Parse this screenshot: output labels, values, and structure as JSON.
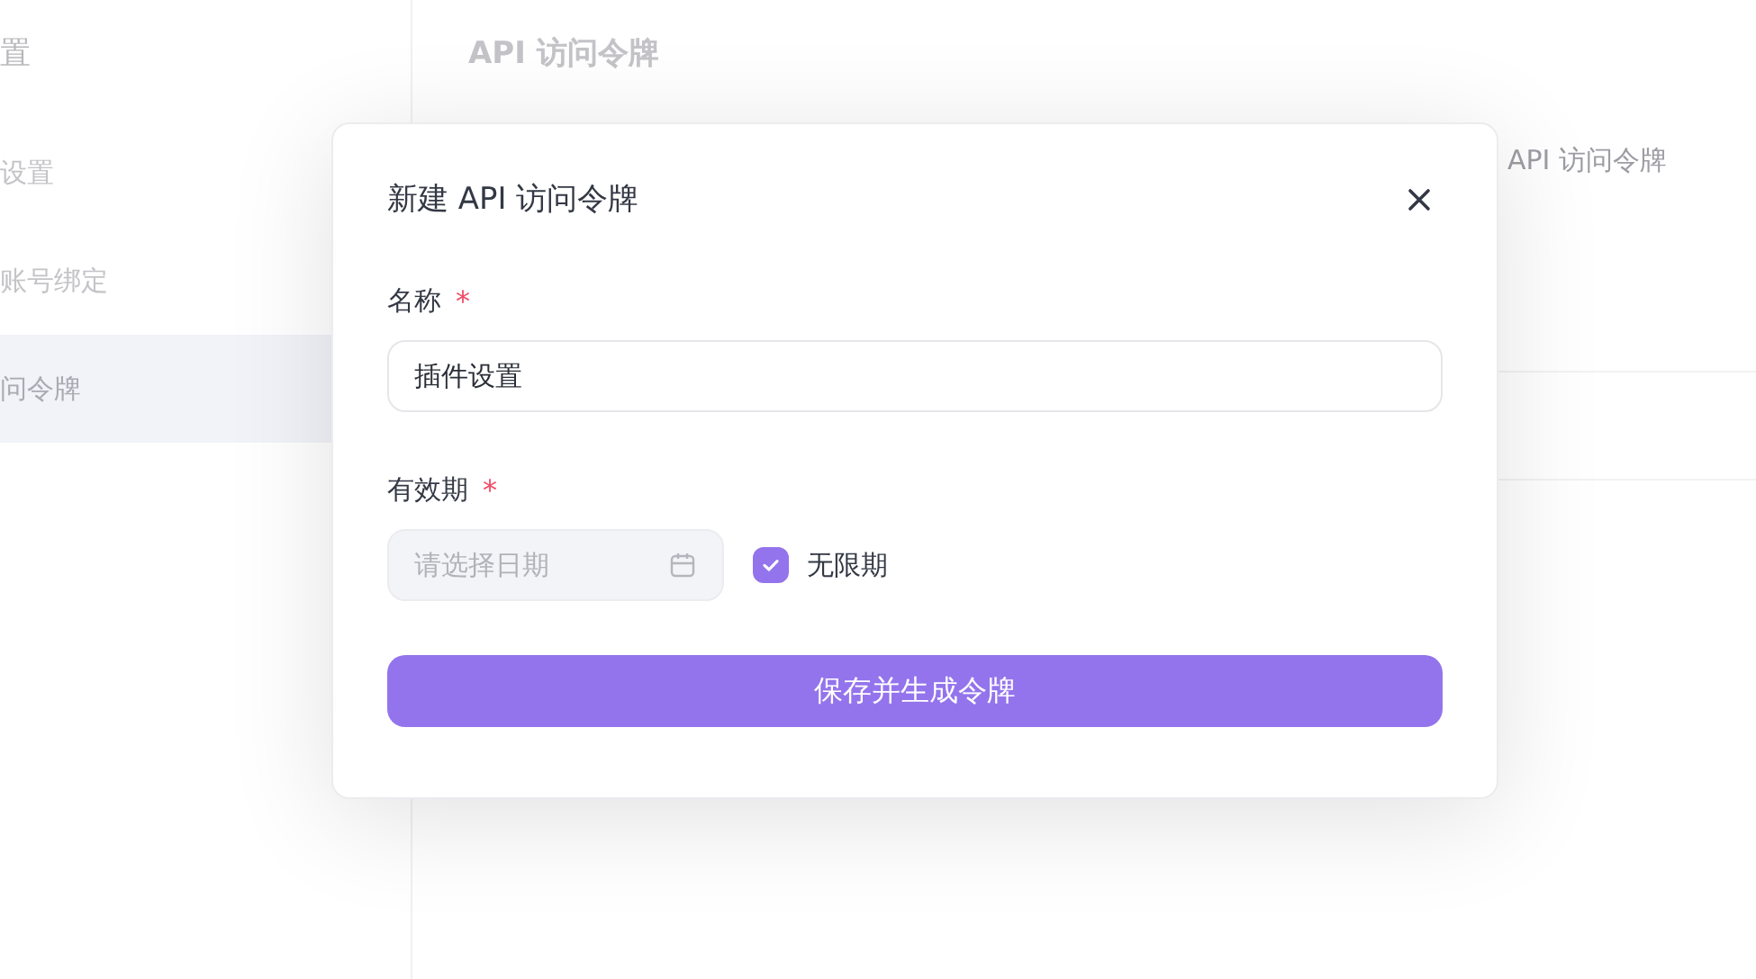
{
  "sidebar": {
    "title": "置",
    "items": [
      {
        "label": "设置",
        "selected": false
      },
      {
        "label": "账号绑定",
        "selected": false
      },
      {
        "label": "问令牌",
        "selected": true
      }
    ]
  },
  "page": {
    "title": "API 访问令牌",
    "partial_text": "API 访问令牌"
  },
  "dialog": {
    "title": "新建 API 访问令牌",
    "name_field": {
      "label": "名称",
      "required_mark": "*",
      "value": "插件设置"
    },
    "expiry_field": {
      "label": "有效期",
      "required_mark": "*",
      "placeholder": "请选择日期",
      "disabled": true
    },
    "no_expiry": {
      "label": "无限期",
      "checked": true
    },
    "submit": {
      "label": "保存并生成令牌"
    }
  }
}
